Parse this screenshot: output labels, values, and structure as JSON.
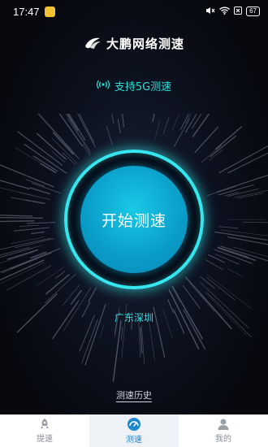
{
  "status_bar": {
    "time": "17:47",
    "battery": "67",
    "icons": [
      "app-notification-icon",
      "mute-icon",
      "wifi-icon",
      "sim-x-icon",
      "battery-icon"
    ]
  },
  "header": {
    "title": "大鹏网络测速",
    "logo": "dapeng-logo-icon"
  },
  "support": {
    "label": "支持5G测速",
    "icon": "signal-broadcast-icon"
  },
  "start_button": {
    "label": "开始测速"
  },
  "location": "广东深圳",
  "history_link": "测速历史",
  "bottom_nav": {
    "items": [
      {
        "label": "提速",
        "icon": "rocket-icon",
        "active": false
      },
      {
        "label": "测速",
        "icon": "speedometer-icon",
        "active": true
      },
      {
        "label": "我的",
        "icon": "user-icon",
        "active": false
      }
    ]
  },
  "colors": {
    "accent": "#27e0d6",
    "button": "#0a9cc8",
    "nav_active": "#1f86d0"
  }
}
